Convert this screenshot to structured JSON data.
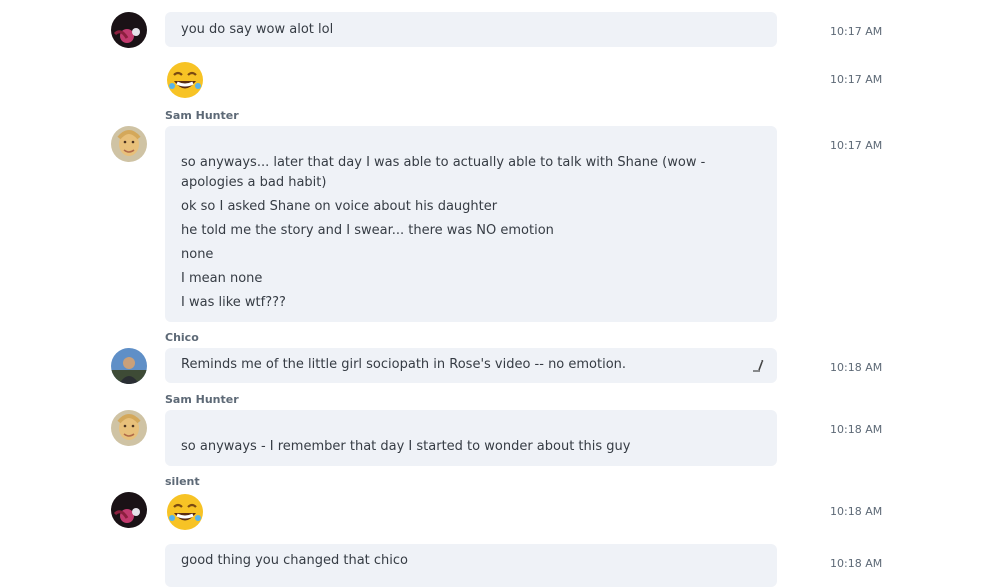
{
  "messages": [
    {
      "text": "you do say wow alot lol",
      "time": "10:17 AM"
    },
    {
      "emoji": "rofl-emoji",
      "time": "10:17 AM"
    },
    {
      "sender": "Sam Hunter",
      "lines": [
        "so anyways... later that day I was able to actually able to talk with Shane (wow - apologies a bad habit)",
        "ok so I asked Shane on voice about his daughter",
        "he told me the story and I swear... there was NO emotion",
        "none",
        "I mean none",
        "I was like wtf???"
      ],
      "time": "10:17 AM"
    },
    {
      "sender": "Chico",
      "text": "Reminds me of the little girl sociopath in Rose's video -- no emotion.",
      "time": "10:18 AM",
      "icon": "edited-pencil-icon"
    },
    {
      "sender": "Sam Hunter",
      "text": "so anyways - I remember that day I started to wonder about this guy",
      "time": "10:18 AM"
    },
    {
      "sender": "silent",
      "emoji": "rofl-emoji",
      "time": "10:18 AM"
    },
    {
      "text": "good thing you changed that chico",
      "time": "10:18 AM"
    }
  ]
}
